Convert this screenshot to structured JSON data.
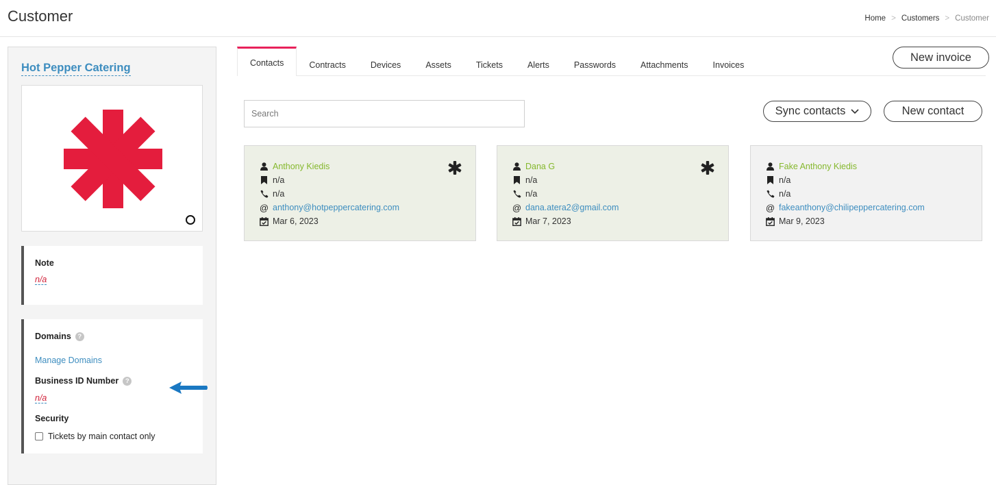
{
  "page": {
    "title": "Customer",
    "breadcrumb": [
      "Home",
      "Customers",
      "Customer"
    ],
    "breadcrumb_sep": ">"
  },
  "sidebar": {
    "customer_name": "Hot Pepper Catering",
    "note": {
      "label": "Note",
      "value": "n/a"
    },
    "domains": {
      "label": "Domains",
      "manage_link": "Manage Domains",
      "help": "?"
    },
    "business_id": {
      "label": "Business ID Number",
      "value": "n/a",
      "help": "?"
    },
    "security": {
      "label": "Security",
      "checkbox_label": "Tickets by main contact only",
      "checked": false
    }
  },
  "tabs": [
    "Contacts",
    "Contracts",
    "Devices",
    "Assets",
    "Tickets",
    "Alerts",
    "Passwords",
    "Attachments",
    "Invoices"
  ],
  "active_tab": "Contacts",
  "toolbar": {
    "new_invoice": "New invoice",
    "sync_contacts": "Sync contacts",
    "new_contact": "New contact",
    "search_placeholder": "Search"
  },
  "contacts": [
    {
      "name": "Anthony Kiedis",
      "title": "n/a",
      "phone": "n/a",
      "email": "anthony@hotpeppercatering.com",
      "date": "Mar 6, 2023",
      "main_contact": true
    },
    {
      "name": "Dana G",
      "title": "n/a",
      "phone": "n/a",
      "email": "dana.atera2@gmail.com",
      "date": "Mar 7, 2023",
      "main_contact": true
    },
    {
      "name": "Fake Anthony Kiedis",
      "title": "n/a",
      "phone": "n/a",
      "email": "fakeanthony@chilipeppercatering.com",
      "date": "Mar 9, 2023",
      "main_contact": false
    }
  ],
  "icons": {
    "user": "user-icon",
    "bookmark": "bookmark-icon",
    "phone": "phone-icon",
    "at": "@",
    "calendar": "calendar-icon",
    "asterisk": "asterisk-icon"
  },
  "colors": {
    "tab_active": "#e8215a",
    "link": "#3d8dbf",
    "name": "#85b82d",
    "na_value": "#d1223a",
    "logo": "#e41d3d",
    "card_main": "#edf0e6",
    "arrow": "#1a78c2"
  }
}
